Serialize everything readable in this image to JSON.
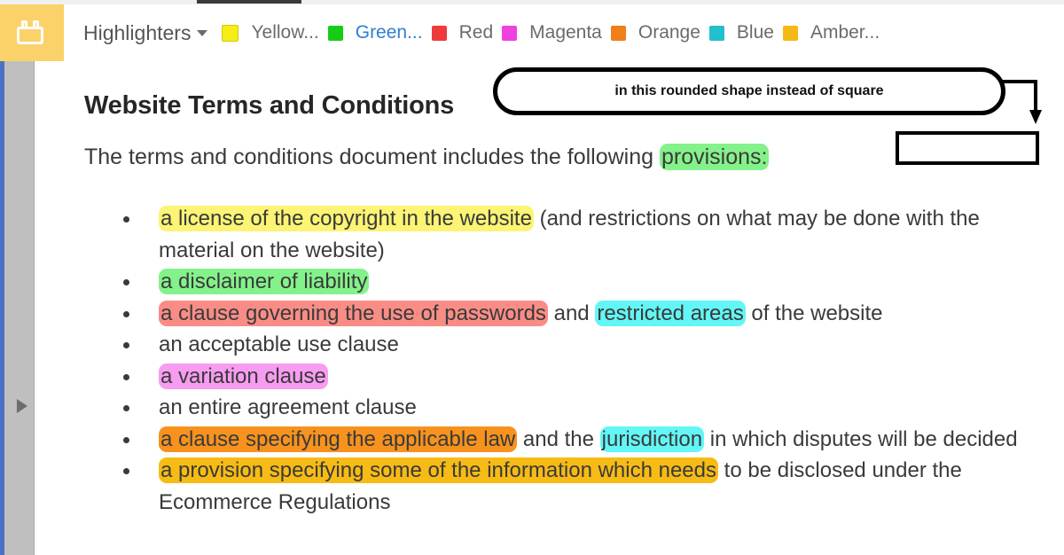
{
  "app": {
    "icon": "toolbox-icon",
    "icon_tile_color": "#fbd169"
  },
  "toolbar": {
    "menu_label": "Highlighters",
    "menu_caret": "chevron-down-icon",
    "items": [
      {
        "name": "Yellow...",
        "color": "#f4ee12",
        "active": false
      },
      {
        "name": "Green...",
        "color": "#17cc17",
        "active": true
      },
      {
        "name": "Red",
        "color": "#ef3b3b",
        "active": false
      },
      {
        "name": "Magenta",
        "color": "#f040e0",
        "active": false
      },
      {
        "name": "Orange",
        "color": "#ef7f16",
        "active": false
      },
      {
        "name": "Blue",
        "color": "#21c0cc",
        "active": false
      },
      {
        "name": "Amber...",
        "color": "#f5b915",
        "active": false
      }
    ]
  },
  "sidebar": {
    "expand_icon": "triangle-right-icon",
    "rail_color": "#4a72c4",
    "panel_color": "#bfbfbf"
  },
  "document": {
    "title": "Website Terms and Conditions",
    "intro_pre": "The terms and conditions document includes the following ",
    "intro_highlight": "provisions:",
    "intro_highlight_color": "#84f28a",
    "bullets": [
      {
        "segments": [
          {
            "text": "a license of the copyright in the website",
            "highlight": "#fbf474"
          },
          {
            "text": " (and restrictions on what may be done with the material on the website)",
            "highlight": null
          }
        ]
      },
      {
        "segments": [
          {
            "text": "a disclaimer of liability",
            "highlight": "#84f28a"
          }
        ]
      },
      {
        "segments": [
          {
            "text": "a clause governing the use of passwords",
            "highlight": "#f98d86"
          },
          {
            "text": " and ",
            "highlight": null
          },
          {
            "text": "restricted areas",
            "highlight": "#62f6f6"
          },
          {
            "text": " of the website",
            "highlight": null
          }
        ]
      },
      {
        "segments": [
          {
            "text": "an acceptable use clause",
            "highlight": null
          }
        ]
      },
      {
        "segments": [
          {
            "text": "a variation clause",
            "highlight": "#f79cf0"
          }
        ]
      },
      {
        "segments": [
          {
            "text": "an entire agreement clause",
            "highlight": null
          }
        ]
      },
      {
        "segments": [
          {
            "text": "a clause specifying the applicable law",
            "highlight": "#f7921e"
          },
          {
            "text": " and the ",
            "highlight": null
          },
          {
            "text": "jurisdiction",
            "highlight": "#62f6f6"
          },
          {
            "text": " in which disputes will be decided",
            "highlight": null
          }
        ]
      },
      {
        "segments": [
          {
            "text": "a provision specifying some of the information which needs",
            "highlight": "#f7bb15"
          },
          {
            "text": " to be disclosed under the Ecommerce Regulations",
            "highlight": null
          }
        ]
      }
    ]
  },
  "annotations": {
    "rounded_note_text": "in this rounded shape instead of square",
    "square_note_text": "",
    "stroke_color": "#000000"
  }
}
